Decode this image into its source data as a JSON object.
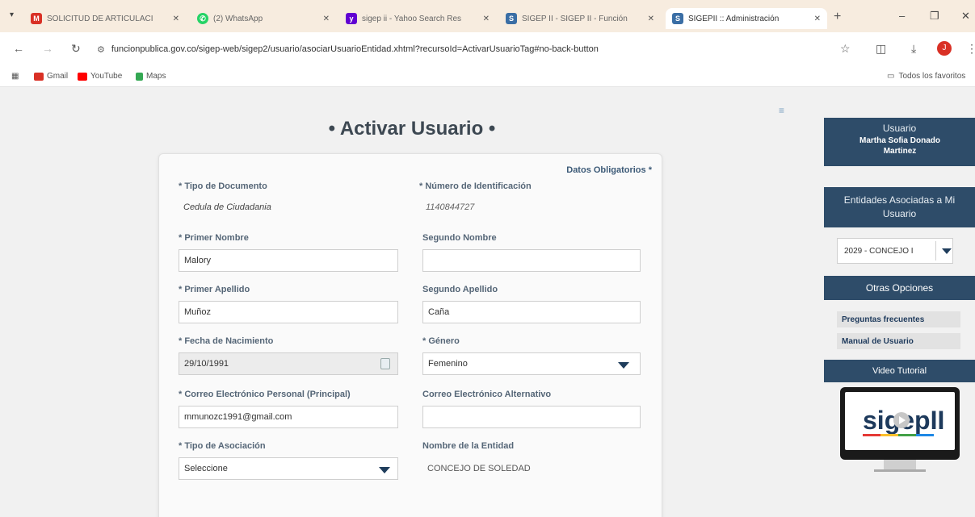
{
  "browser": {
    "tabs": [
      {
        "label": "SOLICITUD DE ARTICULACI",
        "icon": "gmail-icon",
        "color": "#d93025",
        "active": false
      },
      {
        "label": "(2) WhatsApp",
        "icon": "whatsapp-icon",
        "color": "#25d366",
        "active": false
      },
      {
        "label": "sigep ii - Yahoo Search Res",
        "icon": "yahoo-icon",
        "color": "#6001d2",
        "active": false
      },
      {
        "label": "SIGEP II - SIGEP II - Función",
        "icon": "sigep-icon",
        "color": "#3a6ea5",
        "active": false
      },
      {
        "label": "SIGEPII :: Administración",
        "icon": "sigep-icon",
        "color": "#3a6ea5",
        "active": true
      }
    ],
    "url": "funcionpublica.gov.co/sigep-web/sigep2/usuario/asociarUsuarioEntidad.xhtml?recursoId=ActivarUsuarioTag#no-back-button",
    "bookmarks": [
      {
        "label": "Gmail",
        "color": "#d93025"
      },
      {
        "label": "YouTube",
        "color": "#ff0000"
      },
      {
        "label": "Maps",
        "color": "#34a853"
      }
    ],
    "all_bookmarks": "Todos los favoritos",
    "profile_initial": "J"
  },
  "page": {
    "title": "• Activar Usuario •",
    "required_note": "Datos Obligatorios *"
  },
  "form": {
    "tipo_documento": {
      "label": "* Tipo de Documento",
      "value": "Cedula de Ciudadania"
    },
    "numero_identificacion": {
      "label": "* Número de Identificación",
      "value": "1140844727"
    },
    "primer_nombre": {
      "label": "* Primer Nombre",
      "value": "Malory"
    },
    "segundo_nombre": {
      "label": "Segundo Nombre",
      "value": ""
    },
    "primer_apellido": {
      "label": "* Primer Apellido",
      "value": "Muñoz"
    },
    "segundo_apellido": {
      "label": "Segundo Apellido",
      "value": "Caña"
    },
    "fecha_nacimiento": {
      "label": "* Fecha de Nacimiento",
      "value": "29/10/1991"
    },
    "genero": {
      "label": "* Género",
      "value": "Femenino"
    },
    "correo_personal": {
      "label": "* Correo Electrónico Personal (Principal)",
      "value": "mmunozc1991@gmail.com"
    },
    "correo_alternativo": {
      "label": "Correo Electrónico Alternativo",
      "value": ""
    },
    "tipo_asociacion": {
      "label": "* Tipo de Asociación",
      "value": "Seleccione"
    },
    "nombre_entidad": {
      "label": "Nombre de la Entidad",
      "value": "CONCEJO DE SOLEDAD"
    }
  },
  "sidebar": {
    "user_label": "Usuario",
    "user_name": "Martha Sofia Donado Martinez",
    "entities_label": "Entidades Asociadas a Mi Usuario",
    "entity_selected": "2029 - CONCEJO I",
    "other_options_label": "Otras Opciones",
    "links": [
      "Preguntas frecuentes",
      "Manual de Usuario"
    ],
    "video_label": "Video Tutorial",
    "video_logo": "sigepII"
  }
}
